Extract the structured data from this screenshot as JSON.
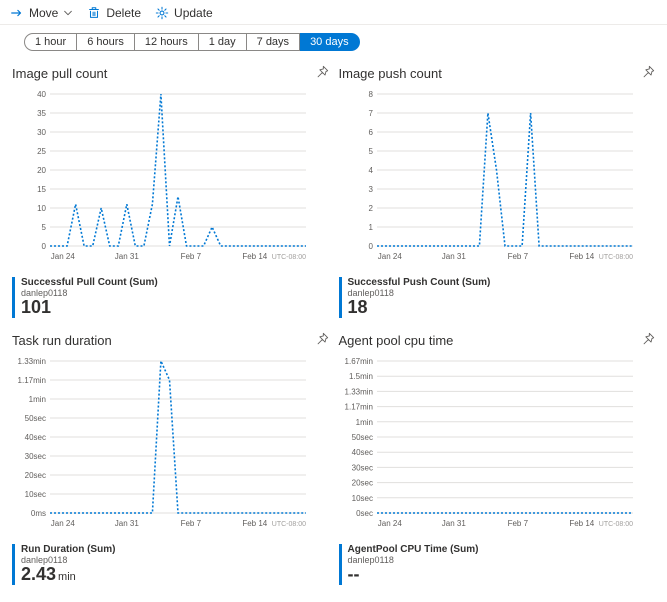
{
  "toolbar": {
    "move_label": "Move",
    "delete_label": "Delete",
    "update_label": "Update"
  },
  "time_tabs": [
    "1 hour",
    "6 hours",
    "12 hours",
    "1 day",
    "7 days",
    "30 days"
  ],
  "time_tab_active": "30 days",
  "charts": [
    {
      "id": "pull",
      "title": "Image pull count",
      "legend_name": "Successful Pull Count (Sum)",
      "legend_sub": "danlep0118",
      "legend_value": "101",
      "legend_unit": ""
    },
    {
      "id": "push",
      "title": "Image push count",
      "legend_name": "Successful Push Count (Sum)",
      "legend_sub": "danlep0118",
      "legend_value": "18",
      "legend_unit": ""
    },
    {
      "id": "duration",
      "title": "Task run duration",
      "legend_name": "Run Duration (Sum)",
      "legend_sub": "danlep0118",
      "legend_value": "2.43",
      "legend_unit": "min"
    },
    {
      "id": "agent",
      "title": "Agent pool cpu time",
      "legend_name": "AgentPool CPU Time (Sum)",
      "legend_sub": "danlep0118",
      "legend_value": "--",
      "legend_unit": ""
    }
  ],
  "chart_data": [
    {
      "type": "line",
      "title": "Image pull count",
      "xlabel": "",
      "ylabel": "",
      "x_ticks": [
        "Jan 24",
        "Jan 31",
        "Feb 7",
        "Feb 14"
      ],
      "x": [
        "Jan 21",
        "Jan 22",
        "Jan 23",
        "Jan 24",
        "Jan 25",
        "Jan 26",
        "Jan 27",
        "Jan 28",
        "Jan 29",
        "Jan 30",
        "Jan 31",
        "Feb 1",
        "Feb 2",
        "Feb 3",
        "Feb 4",
        "Feb 5",
        "Feb 6",
        "Feb 7",
        "Feb 8",
        "Feb 9",
        "Feb 10",
        "Feb 11",
        "Feb 12",
        "Feb 13",
        "Feb 14",
        "Feb 15",
        "Feb 16",
        "Feb 17",
        "Feb 18",
        "Feb 19",
        "Feb 20"
      ],
      "series": [
        {
          "name": "Successful Pull Count (Sum)",
          "values": [
            0,
            0,
            0,
            11,
            0,
            0,
            10,
            0,
            0,
            11,
            0,
            0,
            11,
            40,
            0,
            13,
            0,
            0,
            0,
            5,
            0,
            0,
            0,
            0,
            0,
            0,
            0,
            0,
            0,
            0,
            0
          ]
        }
      ],
      "ylim": [
        0,
        40
      ],
      "y_ticks": [
        0,
        5,
        10,
        15,
        20,
        25,
        30,
        35,
        40
      ],
      "tz": "UTC-08:00"
    },
    {
      "type": "line",
      "title": "Image push count",
      "xlabel": "",
      "ylabel": "",
      "x_ticks": [
        "Jan 24",
        "Jan 31",
        "Feb 7",
        "Feb 14"
      ],
      "x": [
        "Jan 21",
        "Jan 22",
        "Jan 23",
        "Jan 24",
        "Jan 25",
        "Jan 26",
        "Jan 27",
        "Jan 28",
        "Jan 29",
        "Jan 30",
        "Jan 31",
        "Feb 1",
        "Feb 2",
        "Feb 3",
        "Feb 4",
        "Feb 5",
        "Feb 6",
        "Feb 7",
        "Feb 8",
        "Feb 9",
        "Feb 10",
        "Feb 11",
        "Feb 12",
        "Feb 13",
        "Feb 14",
        "Feb 15",
        "Feb 16",
        "Feb 17",
        "Feb 18",
        "Feb 19",
        "Feb 20"
      ],
      "series": [
        {
          "name": "Successful Push Count (Sum)",
          "values": [
            0,
            0,
            0,
            0,
            0,
            0,
            0,
            0,
            0,
            0,
            0,
            0,
            0,
            7,
            4,
            0,
            0,
            0,
            7,
            0,
            0,
            0,
            0,
            0,
            0,
            0,
            0,
            0,
            0,
            0,
            0
          ]
        }
      ],
      "ylim": [
        0,
        8
      ],
      "y_ticks": [
        0,
        1,
        2,
        3,
        4,
        5,
        6,
        7,
        8
      ],
      "tz": "UTC-08:00"
    },
    {
      "type": "line",
      "title": "Task run duration",
      "xlabel": "",
      "ylabel": "",
      "x_ticks": [
        "Jan 24",
        "Jan 31",
        "Feb 7",
        "Feb 14"
      ],
      "x": [
        "Jan 21",
        "Jan 22",
        "Jan 23",
        "Jan 24",
        "Jan 25",
        "Jan 26",
        "Jan 27",
        "Jan 28",
        "Jan 29",
        "Jan 30",
        "Jan 31",
        "Feb 1",
        "Feb 2",
        "Feb 3",
        "Feb 4",
        "Feb 5",
        "Feb 6",
        "Feb 7",
        "Feb 8",
        "Feb 9",
        "Feb 10",
        "Feb 11",
        "Feb 12",
        "Feb 13",
        "Feb 14",
        "Feb 15",
        "Feb 16",
        "Feb 17",
        "Feb 18",
        "Feb 19",
        "Feb 20"
      ],
      "series": [
        {
          "name": "Run Duration (Sum)",
          "values_sec": [
            0,
            0,
            0,
            0,
            0,
            0,
            0,
            0,
            0,
            0,
            0,
            0,
            0,
            80,
            70,
            0,
            0,
            0,
            0,
            0,
            0,
            0,
            0,
            0,
            0,
            0,
            0,
            0,
            0,
            0,
            0
          ]
        }
      ],
      "ylim_sec": [
        0,
        80
      ],
      "y_tick_labels": [
        "0ms",
        "10sec",
        "20sec",
        "30sec",
        "40sec",
        "50sec",
        "1min",
        "1.17min",
        "1.33min"
      ],
      "tz": "UTC-08:00"
    },
    {
      "type": "line",
      "title": "Agent pool cpu time",
      "xlabel": "",
      "ylabel": "",
      "x_ticks": [
        "Jan 24",
        "Jan 31",
        "Feb 7",
        "Feb 14"
      ],
      "x": [
        "Jan 21",
        "Jan 22",
        "Jan 23",
        "Jan 24",
        "Jan 25",
        "Jan 26",
        "Jan 27",
        "Jan 28",
        "Jan 29",
        "Jan 30",
        "Jan 31",
        "Feb 1",
        "Feb 2",
        "Feb 3",
        "Feb 4",
        "Feb 5",
        "Feb 6",
        "Feb 7",
        "Feb 8",
        "Feb 9",
        "Feb 10",
        "Feb 11",
        "Feb 12",
        "Feb 13",
        "Feb 14",
        "Feb 15",
        "Feb 16",
        "Feb 17",
        "Feb 18",
        "Feb 19",
        "Feb 20"
      ],
      "series": [
        {
          "name": "AgentPool CPU Time (Sum)",
          "values_sec": [
            0,
            0,
            0,
            0,
            0,
            0,
            0,
            0,
            0,
            0,
            0,
            0,
            0,
            0,
            0,
            0,
            0,
            0,
            0,
            0,
            0,
            0,
            0,
            0,
            0,
            0,
            0,
            0,
            0,
            0,
            0
          ]
        }
      ],
      "ylim_sec": [
        0,
        100
      ],
      "y_tick_labels": [
        "0sec",
        "10sec",
        "20sec",
        "30sec",
        "40sec",
        "50sec",
        "1min",
        "1.17min",
        "1.33min",
        "1.5min",
        "1.67min"
      ],
      "tz": "UTC-08:00"
    }
  ]
}
